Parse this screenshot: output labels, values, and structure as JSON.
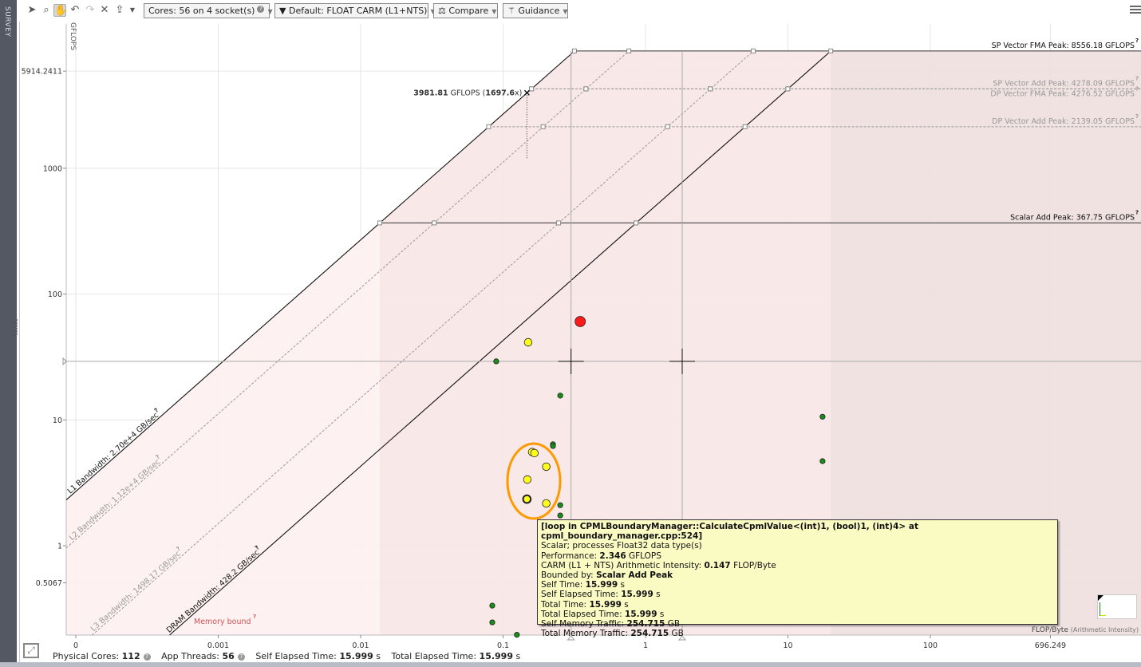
{
  "sidebar": {
    "label": "SURVEY"
  },
  "toolbar": {
    "icons": [
      "pointer-icon",
      "zoom-icon",
      "pan-hand-icon",
      "undo-icon",
      "redo-icon",
      "clear-icon",
      "export-icon"
    ],
    "cores_label": "Cores:  56 on 4 socket(s)",
    "filter_label": "Default: FLOAT CARM (L1+NTS)",
    "compare_label": "Compare",
    "guidance_label": "Guidance"
  },
  "annotation": {
    "value": "3981.81",
    "unit": " GFLOPS (",
    "ratio": "1697.6",
    "suffix": "x)",
    "gflops": 3981.81,
    "ai": 0.147
  },
  "memory_bound_label": "Memory bound",
  "tooltip": {
    "title": "[loop in CPMLBoundaryManager::CalculateCpmlValue<(int)1, (bool)1, (int)4> at cpml_boundary_manager.cpp:524]",
    "line1": "Scalar; processes Float32 data type(s)",
    "rows": [
      {
        "label": "Performance: ",
        "value": "2.346",
        "unit": " GFLOPS"
      },
      {
        "label": "CARM (L1 + NTS) Arithmetic Intensity: ",
        "value": "0.147",
        "unit": " FLOP/Byte"
      },
      {
        "label": "Bounded by: ",
        "value": "Scalar Add Peak",
        "unit": ""
      },
      {
        "label": "Self Time: ",
        "value": "15.999",
        "unit": " s"
      },
      {
        "label": "Self Elapsed Time: ",
        "value": "15.999",
        "unit": " s"
      },
      {
        "label": "Total Time: ",
        "value": "15.999",
        "unit": " s"
      },
      {
        "label": "Total Elapsed Time: ",
        "value": "15.999",
        "unit": " s"
      },
      {
        "label": "Self Memory Traffic: ",
        "value": "254.715",
        "unit": " GB"
      },
      {
        "label": "Total Memory Traffic: ",
        "value": "254.715",
        "unit": " GB"
      }
    ]
  },
  "status": {
    "physical_cores_label": "Physical Cores: ",
    "physical_cores": "112",
    "app_threads_label": "App Threads: ",
    "app_threads": "56",
    "self_elapsed_label": "Self Elapsed Time: ",
    "self_elapsed": "15.999",
    "self_elapsed_unit": " s",
    "total_elapsed_label": "Total Elapsed Time: ",
    "total_elapsed": "15.999",
    "total_elapsed_unit": " s"
  },
  "chart_data": {
    "type": "scatter",
    "title": "",
    "xlabel": "FLOP/Byte",
    "xlabel_note": "(Arithmetic Intensity)",
    "ylabel": "GFLOPS",
    "xscale": "log",
    "yscale": "log",
    "xlim": [
      8.5e-05,
      3000
    ],
    "ylim": [
      0.195,
      14000
    ],
    "grid": true,
    "x_ticks": [
      {
        "v": 0.0001,
        "label": "0"
      },
      {
        "v": 0.001,
        "label": "0.001"
      },
      {
        "v": 0.01,
        "label": "0.01"
      },
      {
        "v": 0.1,
        "label": "0.1"
      },
      {
        "v": 1,
        "label": "1"
      },
      {
        "v": 10,
        "label": "10"
      },
      {
        "v": 100,
        "label": "100"
      },
      {
        "v": 696.249,
        "label": "696.249"
      }
    ],
    "y_ticks": [
      {
        "v": 5914.2411,
        "label": "5914.2411"
      },
      {
        "v": 1000,
        "label": "1000"
      },
      {
        "v": 100,
        "label": "100"
      },
      {
        "v": 10,
        "label": "10"
      },
      {
        "v": 1,
        "label": "1"
      },
      {
        "v": 0.5067,
        "label": "0.5067"
      }
    ],
    "compute_roofs": [
      {
        "name": "SP Vector FMA Peak",
        "value": 8556.18,
        "label": "SP Vector FMA Peak: 8556.18 GFLOPS",
        "style": "solid"
      },
      {
        "name": "SP Vector Add Peak",
        "value": 4278.09,
        "label": "SP Vector Add Peak: 4278.09 GFLOPS",
        "style": "dashed"
      },
      {
        "name": "DP Vector FMA Peak",
        "value": 4276.52,
        "label": "DP Vector FMA Peak: 4276.52 GFLOPS",
        "style": "dashed"
      },
      {
        "name": "DP Vector Add Peak",
        "value": 2139.05,
        "label": "DP Vector Add Peak: 2139.05 GFLOPS",
        "style": "dashed"
      },
      {
        "name": "Scalar Add Peak",
        "value": 367.75,
        "label": "Scalar Add Peak: 367.75 GFLOPS",
        "style": "solid"
      }
    ],
    "memory_roofs": [
      {
        "name": "L1 Bandwidth",
        "value": 27000,
        "label": "L1 Bandwidth: 2.70e+4 GB/sec",
        "style": "solid"
      },
      {
        "name": "L2 Bandwidth",
        "value": 11200,
        "label": "L2 Bandwidth: 1.12e+4 GB/sec",
        "style": "dashed"
      },
      {
        "name": "L3 Bandwidth",
        "value": 1498.17,
        "label": "L3 Bandwidth: 1498.17 GB/sec",
        "style": "dashed"
      },
      {
        "name": "DRAM Bandwidth",
        "value": 428.2,
        "label": "DRAM Bandwidth: 428.2 GB/sec",
        "style": "solid"
      }
    ],
    "points": [
      {
        "x": 0.348,
        "y": 60.5,
        "color": "red"
      },
      {
        "x": 0.15,
        "y": 41.4,
        "color": "yellow"
      },
      {
        "x": 0.0895,
        "y": 29.2,
        "color": "green"
      },
      {
        "x": 0.252,
        "y": 15.6,
        "color": "green"
      },
      {
        "x": 0.224,
        "y": 6.4,
        "color": "green"
      },
      {
        "x": 0.224,
        "y": 6.2,
        "color": "green"
      },
      {
        "x": 0.16,
        "y": 5.55,
        "color": "yellow"
      },
      {
        "x": 0.166,
        "y": 5.45,
        "color": "yellow"
      },
      {
        "x": 0.201,
        "y": 4.25,
        "color": "yellow"
      },
      {
        "x": 0.148,
        "y": 3.36,
        "color": "yellow"
      },
      {
        "x": 0.147,
        "y": 2.346,
        "color": "yellow",
        "selected": true
      },
      {
        "x": 0.201,
        "y": 2.17,
        "color": "yellow"
      },
      {
        "x": 0.252,
        "y": 2.1,
        "color": "green"
      },
      {
        "x": 0.252,
        "y": 1.74,
        "color": "green"
      },
      {
        "x": 17.5,
        "y": 10.6,
        "color": "green"
      },
      {
        "x": 17.5,
        "y": 4.7,
        "color": "green"
      },
      {
        "x": 0.084,
        "y": 0.334,
        "color": "green"
      },
      {
        "x": 0.084,
        "y": 0.246,
        "color": "green"
      },
      {
        "x": 0.125,
        "y": 0.196,
        "color": "green"
      }
    ],
    "guides": {
      "y": 29.2,
      "x": [
        0.3,
        1.81
      ]
    },
    "colors": {
      "red": "#ff1a1a",
      "yellow": "#ffff1a",
      "green": "#1a8c1a",
      "highlight": "#ff9900",
      "memory_bound": "#d05555"
    }
  }
}
